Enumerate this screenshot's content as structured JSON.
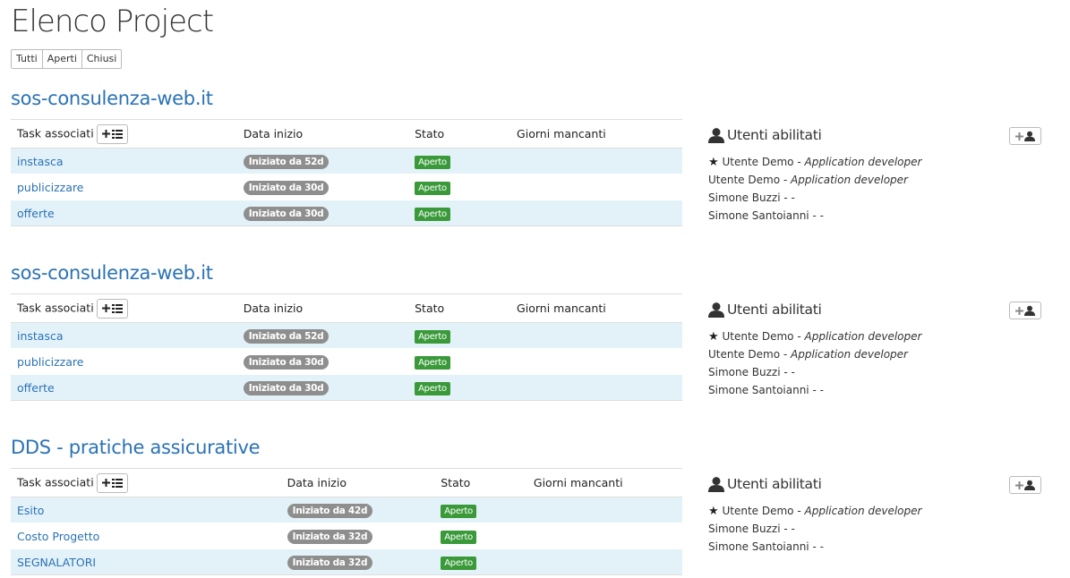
{
  "page_title": "Elenco Project",
  "filters": [
    "Tutti",
    "Aperti",
    "Chiusi"
  ],
  "projects": [
    {
      "title": "sos-consulenza-web.it",
      "columns": [
        "Task associati",
        "Data inizio",
        "Stato",
        "Giorni mancanti"
      ],
      "tasks": [
        {
          "name": "instasca",
          "start": "Iniziato da 52d",
          "status": "Aperto",
          "days_left": ""
        },
        {
          "name": "publicizzare",
          "start": "Iniziato da 30d",
          "status": "Aperto",
          "days_left": ""
        },
        {
          "name": "offerte",
          "start": "Iniziato da 30d",
          "status": "Aperto",
          "days_left": ""
        }
      ],
      "users_title": "Utenti abilitati",
      "users": [
        {
          "starred": true,
          "name": "Utente Demo",
          "role": "Application developer"
        },
        {
          "starred": false,
          "name": "Utente Demo",
          "role": "Application developer"
        },
        {
          "starred": false,
          "name": "Simone Buzzi",
          "role": "-"
        },
        {
          "starred": false,
          "name": "Simone Santoianni",
          "role": "-"
        }
      ]
    },
    {
      "title": "sos-consulenza-web.it",
      "columns": [
        "Task associati",
        "Data inizio",
        "Stato",
        "Giorni mancanti"
      ],
      "tasks": [
        {
          "name": "instasca",
          "start": "Iniziato da 52d",
          "status": "Aperto",
          "days_left": ""
        },
        {
          "name": "publicizzare",
          "start": "Iniziato da 30d",
          "status": "Aperto",
          "days_left": ""
        },
        {
          "name": "offerte",
          "start": "Iniziato da 30d",
          "status": "Aperto",
          "days_left": ""
        }
      ],
      "users_title": "Utenti abilitati",
      "users": [
        {
          "starred": true,
          "name": "Utente Demo",
          "role": "Application developer"
        },
        {
          "starred": false,
          "name": "Utente Demo",
          "role": "Application developer"
        },
        {
          "starred": false,
          "name": "Simone Buzzi",
          "role": "-"
        },
        {
          "starred": false,
          "name": "Simone Santoianni",
          "role": "-"
        }
      ]
    },
    {
      "title": "DDS - pratiche assicurative",
      "columns": [
        "Task associati",
        "Data inizio",
        "Stato",
        "Giorni mancanti"
      ],
      "tasks": [
        {
          "name": "Esito",
          "start": "Iniziato da 42d",
          "status": "Aperto",
          "days_left": ""
        },
        {
          "name": "Costo Progetto",
          "start": "Iniziato da 32d",
          "status": "Aperto",
          "days_left": ""
        },
        {
          "name": "SEGNALATORI",
          "start": "Iniziato da 32d",
          "status": "Aperto",
          "days_left": ""
        }
      ],
      "users_title": "Utenti abilitati",
      "users": [
        {
          "starred": true,
          "name": "Utente Demo",
          "role": "Application developer"
        },
        {
          "starred": false,
          "name": "Simone Buzzi",
          "role": "-"
        },
        {
          "starred": false,
          "name": "Simone Santoianni",
          "role": "-"
        }
      ]
    }
  ],
  "colors": {
    "link": "#2a72b5",
    "row_stripe": "#e3f2f9",
    "status_open": "#3a9a3a",
    "date_badge": "#8e8e8e"
  },
  "icons": [
    "plus-icon",
    "list-icon",
    "user-icon",
    "star-icon"
  ]
}
